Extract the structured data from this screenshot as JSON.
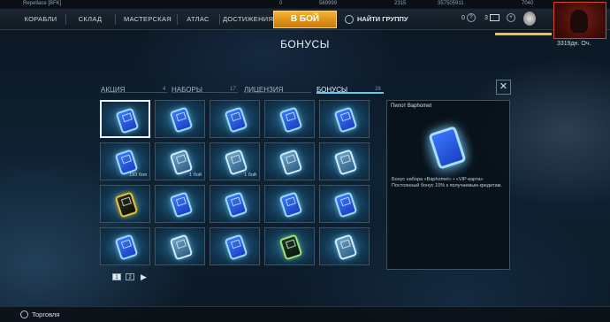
{
  "topstrip": {
    "player": "Repellace [BFK]",
    "res_a": "0",
    "res_b": "569999",
    "res_c": "2315",
    "res_d": "357505911",
    "res_e": "7040"
  },
  "nav": {
    "items": [
      "КОРАБЛИ",
      "СКЛАД",
      "МАСТЕРСКАЯ",
      "АТЛАС",
      "ДОСТИЖЕНИЯ"
    ],
    "battle_label": "В БОЙ",
    "group_label": "НАЙТИ ГРУППУ",
    "help_count": "0",
    "mail_count": "3",
    "score": "3319дн. Оч."
  },
  "page": {
    "title": "БОНУСЫ"
  },
  "tabs": [
    {
      "label": "АКЦИЯ",
      "count": "4"
    },
    {
      "label": "НАБОРЫ",
      "count": "17"
    },
    {
      "label": "ЛИЦЕНЗИЯ",
      "count": ""
    },
    {
      "label": "БОНУСЫ",
      "count": "28"
    }
  ],
  "grid": {
    "cells": [
      {
        "variant": "blue",
        "label": "",
        "selected": true
      },
      {
        "variant": "blue",
        "label": ""
      },
      {
        "variant": "blue",
        "label": ""
      },
      {
        "variant": "blue",
        "label": ""
      },
      {
        "variant": "blue",
        "label": ""
      },
      {
        "variant": "blue",
        "label": "193 боя"
      },
      {
        "variant": "pale",
        "label": "1 бой"
      },
      {
        "variant": "pale",
        "label": "1 бой"
      },
      {
        "variant": "pale",
        "label": ""
      },
      {
        "variant": "pale",
        "label": ""
      },
      {
        "variant": "gold",
        "label": ""
      },
      {
        "variant": "blue",
        "label": ""
      },
      {
        "variant": "blue",
        "label": ""
      },
      {
        "variant": "blue",
        "label": ""
      },
      {
        "variant": "blue",
        "label": ""
      },
      {
        "variant": "blue",
        "label": ""
      },
      {
        "variant": "pale",
        "label": ""
      },
      {
        "variant": "blue",
        "label": ""
      },
      {
        "variant": "green",
        "label": ""
      },
      {
        "variant": "pale",
        "label": ""
      }
    ]
  },
  "pager": {
    "pages": [
      "1",
      "2"
    ],
    "current": "1"
  },
  "detail": {
    "title": "Пилот Baphomet",
    "description": "Бонус набора «Baphomet» • «VIP-карта» Постоянный бонус 10% к получаемым кредитам."
  },
  "footer": {
    "label": "Торговля"
  },
  "colors": {
    "accent": "#6fc7ee",
    "battle": "#e6961f",
    "panel": "#0a1620"
  }
}
